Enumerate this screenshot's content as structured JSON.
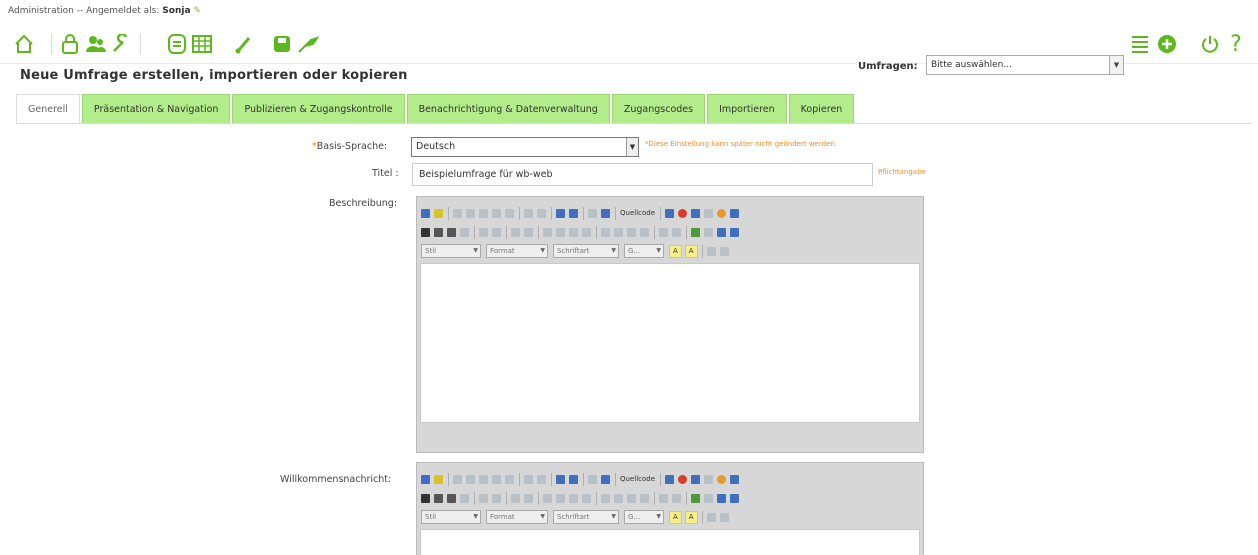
{
  "session": {
    "admin_label": "Administration",
    "separator": "--",
    "logged_in_as": "Angemeldet als:",
    "username": "Sonja"
  },
  "toolbar": {
    "icons": [
      "home-icon",
      "lock-icon",
      "users-icon",
      "wrench-icon",
      "database-icon",
      "table-icon",
      "brush-icon",
      "save-icon",
      "plugin-icon",
      "list-icon",
      "add-icon",
      "power-icon",
      "help-icon"
    ],
    "accent_color": "#5cb81d",
    "survey_label": "Umfragen:",
    "survey_select_value": "Bitte auswählen..."
  },
  "page_title": "Neue Umfrage erstellen, importieren oder kopieren",
  "tabs": [
    {
      "label": "Generell",
      "active": true
    },
    {
      "label": "Präsentation & Navigation"
    },
    {
      "label": "Publizieren & Zugangskontrolle"
    },
    {
      "label": "Benachrichtigung & Datenverwaltung"
    },
    {
      "label": "Zugangscodes"
    },
    {
      "label": "Importieren"
    },
    {
      "label": "Kopieren"
    }
  ],
  "form": {
    "base_language": {
      "required_mark": "*",
      "label": "Basis-Sprache:",
      "value": "Deutsch",
      "hint": "*Diese Einstellung kann später nicht geändert werden."
    },
    "title": {
      "label": "Titel :",
      "value": "Beispielumfrage für wb-web",
      "hint": "Pflichtangabe"
    },
    "description": {
      "label": "Beschreibung:"
    },
    "welcome": {
      "label": "Willkommensnachricht:"
    }
  },
  "editor": {
    "source_label": "Quellcode",
    "style_combo": "Stil",
    "format_combo": "Format",
    "font_combo": "Schriftart",
    "size_combo": "G...",
    "text_color_label": "A",
    "bg_color_label": "A"
  }
}
